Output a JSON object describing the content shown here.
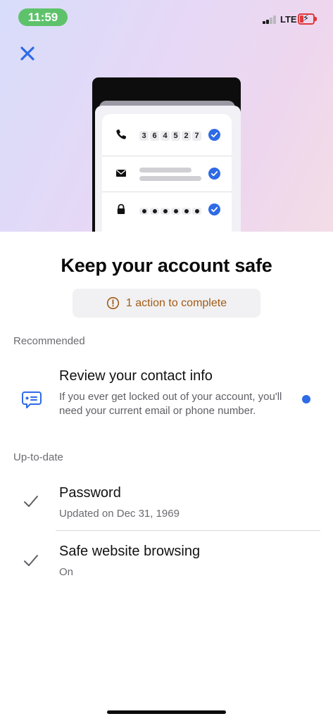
{
  "status_bar": {
    "time": "11:59",
    "network": "LTE"
  },
  "close_icon": "close-icon",
  "illustration": {
    "phone_digits": [
      "3",
      "6",
      "4",
      "5",
      "2",
      "7"
    ],
    "row_icons": [
      "phone-icon",
      "envelope-icon",
      "lock-icon"
    ]
  },
  "page_title": "Keep your account safe",
  "action_pill": {
    "text": "1 action to complete",
    "icon": "warning-circle-icon"
  },
  "recommended": {
    "section_label": "Recommended",
    "items": [
      {
        "title": "Review your contact info",
        "description": "If you ever get locked out of your account, you'll need your current email or phone number.",
        "icon": "chat-info-icon"
      }
    ]
  },
  "up_to_date": {
    "section_label": "Up-to-date",
    "items": [
      {
        "title": "Password",
        "subtitle": "Updated on Dec 31, 1969",
        "icon": "checkmark-icon"
      },
      {
        "title": "Safe website browsing",
        "subtitle": "On",
        "icon": "checkmark-icon"
      }
    ]
  },
  "colors": {
    "accent_blue": "#2e6be6",
    "warning_text": "#a25a14",
    "status_green": "#5ec26a",
    "battery_red": "#e0383b"
  }
}
